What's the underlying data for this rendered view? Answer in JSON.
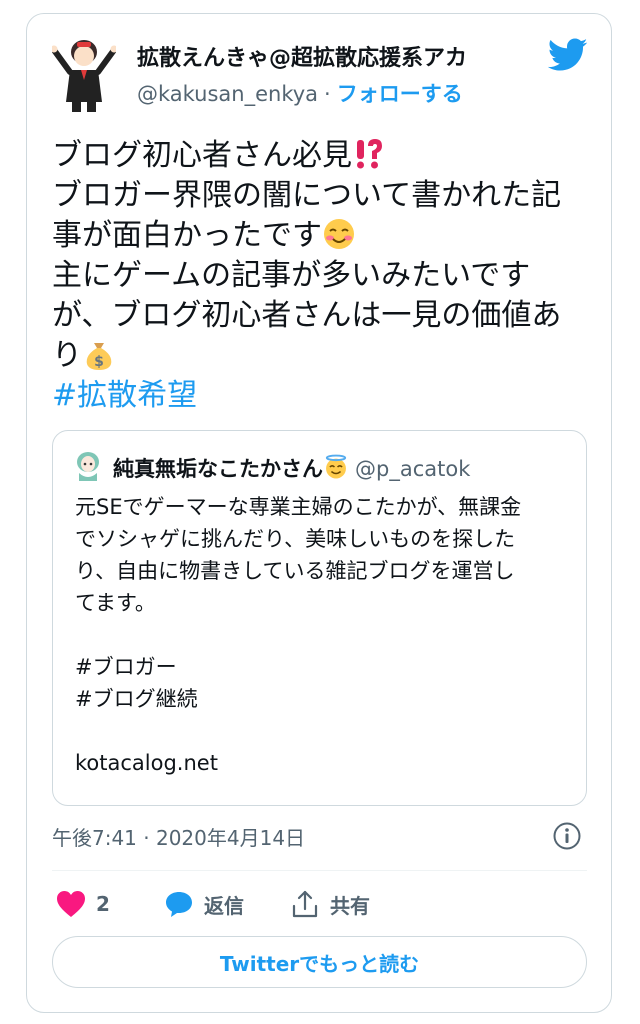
{
  "tweet": {
    "author": {
      "name": "拡散えんきゃ@超拡散応援系アカ",
      "handle": "@kakusan_enkya",
      "separator": "·",
      "follow_label": "フォローする"
    },
    "text_lines": [
      "ブログ初心者さん必見",
      "ブロガー界隈の闇について書かれた記",
      "事が面白かったです",
      "主にゲームの記事が多いみたいです",
      "が、ブログ初心者さんは一見の価値あ",
      "り"
    ],
    "hashtag": "#拡散希望",
    "timestamp": "午後7:41 · 2020年4月14日"
  },
  "quote": {
    "name": "純真無垢なこたかさん",
    "handle": "@p_acatok",
    "body_lines": [
      "元SEでゲーマーな専業主婦のこたかが、無課金",
      "でソシャゲに挑んだり、美味しいものを探した",
      "り、自由に物書きしている雑記ブログを運営し",
      "てます。"
    ],
    "tags": [
      "#ブロガー",
      "#ブログ継続"
    ],
    "link": "kotacalog.net"
  },
  "actions": {
    "like_count": "2",
    "reply_label": "返信",
    "share_label": "共有"
  },
  "more_button_label": "Twitterでもっと読む",
  "colors": {
    "accent": "#1d9bf0",
    "like": "#f91880",
    "text": "#0f1419",
    "secondary": "#536471",
    "border": "#cfd9de"
  },
  "icons": {
    "brand": "twitter-bird-icon",
    "emoji_1": "exclamation-question-emoji",
    "emoji_2": "smiling-blush-emoji",
    "emoji_3": "money-bag-emoji",
    "quote_emoji": "halo-smile-emoji",
    "like": "heart-icon",
    "reply": "speech-bubble-icon",
    "share": "share-icon",
    "info": "info-icon"
  }
}
